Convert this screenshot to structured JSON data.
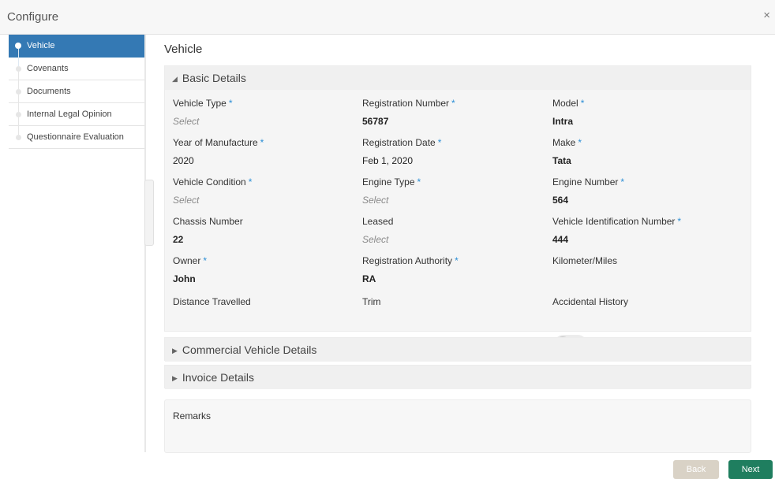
{
  "dialog": {
    "title": "Configure",
    "close_symbol": "×"
  },
  "sidebar": {
    "items": [
      {
        "label": "Vehicle",
        "active": true
      },
      {
        "label": "Covenants",
        "active": false
      },
      {
        "label": "Documents",
        "active": false
      },
      {
        "label": "Internal Legal Opinion",
        "active": false
      },
      {
        "label": "Questionnaire Evaluation",
        "active": false
      }
    ]
  },
  "page": {
    "title": "Vehicle"
  },
  "basic_details": {
    "header": "Basic Details",
    "fields": {
      "vehicle_type": {
        "label": "Vehicle Type",
        "value": "Select",
        "required": true
      },
      "registration_number": {
        "label": "Registration Number",
        "value": "56787",
        "required": true
      },
      "model": {
        "label": "Model",
        "value": "Intra",
        "required": true
      },
      "year_of_manufacture": {
        "label": "Year of Manufacture",
        "value": "2020",
        "required": true
      },
      "registration_date": {
        "label": "Registration Date",
        "value": "Feb 1, 2020",
        "required": true
      },
      "make": {
        "label": "Make",
        "value": "Tata",
        "required": true
      },
      "vehicle_condition": {
        "label": "Vehicle Condition",
        "value": "Select",
        "required": true
      },
      "engine_type": {
        "label": "Engine Type",
        "value": "Select",
        "required": true
      },
      "engine_number": {
        "label": "Engine Number",
        "value": "564",
        "required": true
      },
      "chassis_number": {
        "label": "Chassis Number",
        "value": "22",
        "required": false
      },
      "leased": {
        "label": "Leased",
        "value": "Select",
        "required": false
      },
      "vin": {
        "label": "Vehicle Identification Number",
        "value": "444",
        "required": true
      },
      "owner": {
        "label": "Owner",
        "value": "John",
        "required": true
      },
      "registration_authority": {
        "label": "Registration Authority",
        "value": "RA",
        "required": true
      },
      "kilometer_miles": {
        "label": "Kilometer/Miles",
        "value": "",
        "required": false
      },
      "distance_travelled": {
        "label": "Distance Travelled",
        "value": "",
        "required": false
      },
      "trim": {
        "label": "Trim",
        "value": "",
        "required": false
      },
      "accidental_history": {
        "label": "Accidental History",
        "enabled": false
      }
    },
    "required_marker": "*"
  },
  "commercial_vehicle_details": {
    "header": "Commercial Vehicle Details"
  },
  "invoice_details": {
    "header": "Invoice Details"
  },
  "remarks": {
    "label": "Remarks"
  },
  "footer": {
    "back_label": "Back",
    "next_label": "Next"
  },
  "colors": {
    "accent": "#3479b4",
    "required": "#2c8fd6",
    "next_button": "#1f7e5f",
    "back_button": "#d9d2c6"
  }
}
